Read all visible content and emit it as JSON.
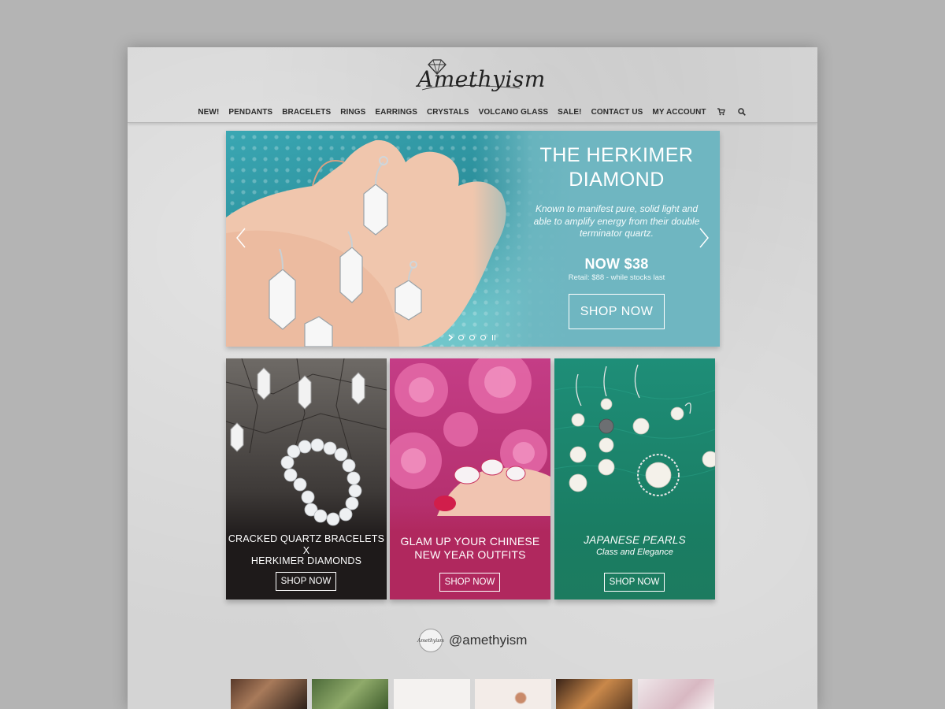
{
  "brand": {
    "logo_text": "Amethyism"
  },
  "nav": {
    "items": [
      "NEW!",
      "PENDANTS",
      "BRACELETS",
      "RINGS",
      "EARRINGS",
      "CRYSTALS",
      "VOLCANO GLASS",
      "SALE!",
      "CONTACT US",
      "MY ACCOUNT"
    ],
    "icons": [
      "cart-icon",
      "search-icon"
    ]
  },
  "hero": {
    "title": "THE HERKIMER DIAMOND",
    "description": "Known to manifest pure, solid light and able to amplify energy from their double terminator quartz.",
    "price": "NOW $38",
    "retail": "Retail: $88 - while stocks last",
    "cta": "SHOP NOW",
    "slides_shown": 3,
    "colors": {
      "panel": "#6fb6c1"
    }
  },
  "tiles": [
    {
      "title_line1": "CRACKED QUARTZ BRACELETS",
      "title_line2": "X",
      "title_line3": "HERKIMER DIAMONDS",
      "cta": "SHOP NOW",
      "color": "#1e1a1a"
    },
    {
      "title_line1": "GLAM UP YOUR CHINESE",
      "title_line2": "NEW YEAR OUTFITS",
      "cta": "SHOP NOW",
      "color": "#b0285e"
    },
    {
      "title": "JAPANESE PEARLS",
      "subtitle": "Class and Elegance",
      "cta": "SHOP NOW",
      "color": "#1c7b5f"
    }
  ],
  "social": {
    "avatar_text": "Amethyism",
    "handle": "@amethyism"
  }
}
